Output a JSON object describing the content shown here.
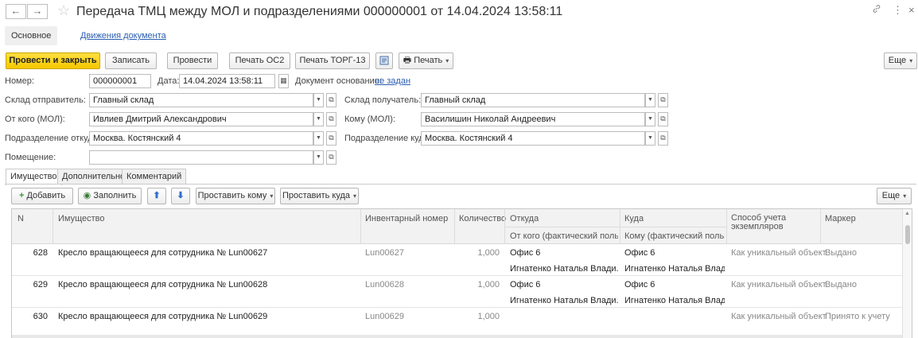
{
  "window": {
    "title": "Передача ТМЦ между МОЛ и подразделениями 000000001 от 14.04.2024 13:58:11",
    "back": "←",
    "forward": "→",
    "link_icon": "🔗",
    "more_icon": "⋮",
    "close_icon": "×"
  },
  "sections": {
    "main": "Основное",
    "movements": "Движения документа"
  },
  "toolbar": {
    "post_close": "Провести и закрыть",
    "save": "Записать",
    "post": "Провести",
    "print_os2": "Печать ОС2",
    "print_torg13": "Печать ТОРГ-13",
    "print": "Печать",
    "more": "Еще"
  },
  "form": {
    "number_label": "Номер:",
    "number": "000000001",
    "date_label": "Дата:",
    "date": "14.04.2024 13:58:11",
    "basis_label": "Документ основание:",
    "basis_value": "не задан",
    "sender_wh_label": "Склад отправитель:",
    "sender_wh": "Главный склад",
    "receiver_wh_label": "Склад получатель:",
    "receiver_wh": "Главный склад",
    "from_mol_label": "От кого (МОЛ):",
    "from_mol": "Ивлиев Дмитрий Александрович",
    "to_mol_label": "Кому (МОЛ):",
    "to_mol": "Василишин Николай Андреевич",
    "from_dept_label": "Подразделение откуда:",
    "from_dept": "Москва. Костянский 4",
    "to_dept_label": "Подразделение куда:",
    "to_dept": "Москва. Костянский 4",
    "room_label": "Помещение:",
    "room": ""
  },
  "tabs": [
    "Имущество",
    "Дополнительно",
    "Комментарий"
  ],
  "table_toolbar": {
    "add": "Добавить",
    "fill": "Заполнить",
    "set_to": "Проставить кому",
    "set_where": "Проставить куда",
    "more": "Еще"
  },
  "table": {
    "headers": {
      "n": "N",
      "item": "Имущество",
      "inv": "Инвентарный номер",
      "qty": "Количество",
      "from": "Откуда",
      "from_sub": "От кого (фактический поль...",
      "to": "Куда",
      "to_sub": "Кому (фактический польз...",
      "method": "Способ учета экземпляров",
      "marker": "Маркер"
    },
    "rows": [
      {
        "n": "628",
        "item": "Кресло вращающееся для сотрудника № Lun00627",
        "inv": "Lun00627",
        "qty": "1,000",
        "from": "Офис 6",
        "from_user": "Игнатенко Наталья Влади...",
        "to": "Офис 6",
        "to_user": "Игнатенко Наталья Влад...",
        "method": "Как уникальный объект",
        "marker": "Выдано"
      },
      {
        "n": "629",
        "item": "Кресло вращающееся для сотрудника № Lun00628",
        "inv": "Lun00628",
        "qty": "1,000",
        "from": "Офис 6",
        "from_user": "Игнатенко Наталья Влади...",
        "to": "Офис 6",
        "to_user": "Игнатенко Наталья Влад...",
        "method": "Как уникальный объект",
        "marker": "Выдано"
      },
      {
        "n": "630",
        "item": "Кресло вращающееся для сотрудника № Lun00629",
        "inv": "Lun00629",
        "qty": "1,000",
        "from": "",
        "from_user": "",
        "to": "",
        "to_user": "",
        "method": "Как уникальный объект",
        "marker": "Принято к учету"
      }
    ]
  },
  "colors": {
    "primary": "#f5c700",
    "link": "#2a5db0",
    "star": "#c9c9c9"
  }
}
